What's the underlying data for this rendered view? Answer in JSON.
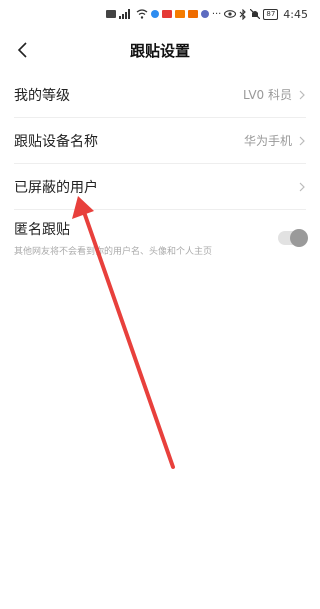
{
  "status_bar": {
    "time": "4:45",
    "battery": "87",
    "icons": [
      "nfc-icon",
      "signal-icon",
      "wifi-icon",
      "shield-icon",
      "app-badge-icon",
      "app-badge-icon",
      "app-badge-icon",
      "more-icon",
      "eye-icon",
      "bluetooth-icon",
      "mute-icon",
      "battery-icon"
    ],
    "more": "···"
  },
  "nav": {
    "title": "跟贴设置",
    "back_icon": "chevron-left-icon"
  },
  "settings": {
    "level": {
      "label": "我的等级",
      "value": "LV0 科员"
    },
    "device": {
      "label": "跟贴设备名称",
      "value": "华为手机"
    },
    "blocked": {
      "label": "已屏蔽的用户"
    },
    "anonymous": {
      "label": "匿名跟贴",
      "description": "其他网友将不会看到你的用户名、头像和个人主页",
      "enabled": false
    }
  },
  "colors": {
    "annotation_arrow": "#e8403c",
    "divider": "#eeeeee",
    "muted_text": "#999999"
  }
}
